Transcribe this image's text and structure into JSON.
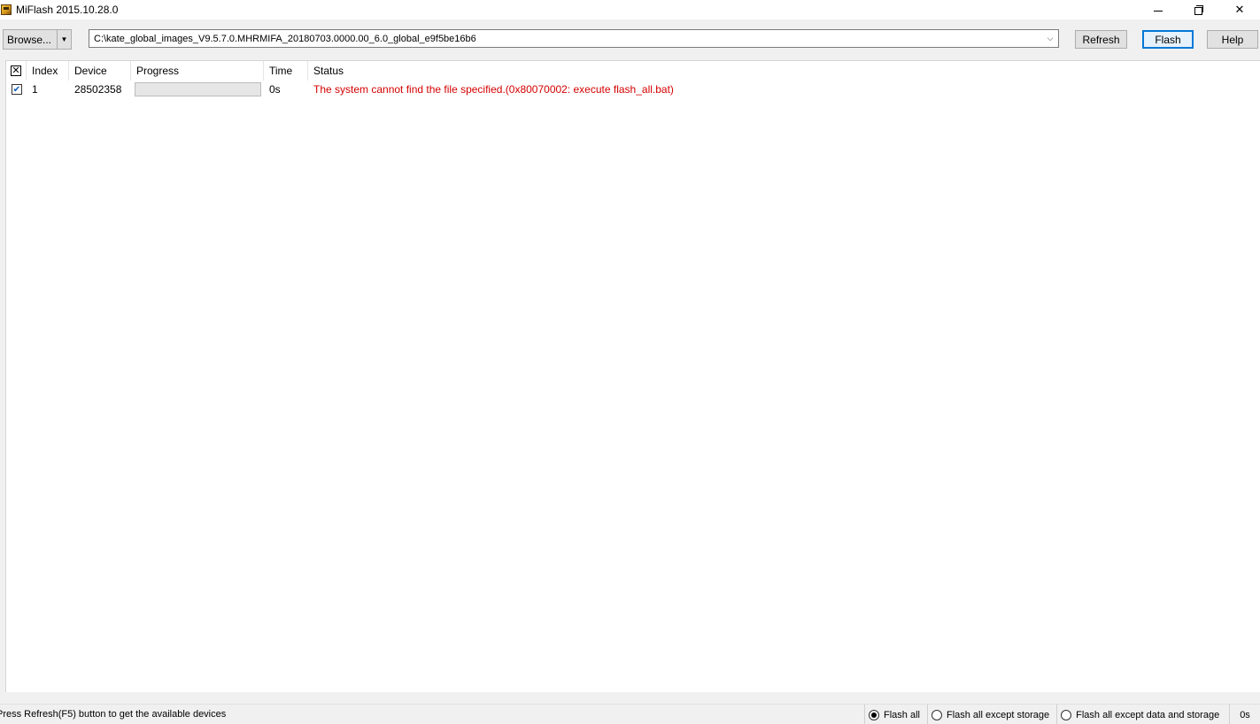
{
  "window": {
    "title": "MiFlash 2015.10.28.0",
    "icon": "miflash-app-icon",
    "controls": {
      "minimize": "minimize-icon",
      "restore": "restore-icon",
      "close": "✕"
    }
  },
  "toolbar": {
    "browse_label": "Browse...",
    "browse_dropdown": "▼",
    "path_value": "C:\\kate_global_images_V9.5.7.0.MHRMIFA_20180703.0000.00_6.0_global_e9f5be16b6",
    "path_dropdown": "⌵",
    "refresh_label": "Refresh",
    "flash_label": "Flash",
    "help_label": "Help"
  },
  "table": {
    "header_check": "✕",
    "columns": [
      "Index",
      "Device",
      "Progress",
      "Time",
      "Status"
    ],
    "rows": [
      {
        "checked": "✔",
        "index": "1",
        "device": "28502358",
        "progress": 0,
        "time": "0s",
        "status": "The system cannot find the file specified.(0x80070002: execute flash_all.bat)",
        "status_color": "#d40000"
      }
    ]
  },
  "statusbar": {
    "message": "Press Refresh(F5) button to get the available devices",
    "modes": [
      {
        "label": "Flash all",
        "selected": true
      },
      {
        "label": "Flash all except storage",
        "selected": false
      },
      {
        "label": "Flash all except data and storage",
        "selected": false
      }
    ],
    "elapsed": "0s"
  },
  "colors": {
    "accent": "#0078d7",
    "error": "#d40000",
    "progress_fill": "#06b025"
  }
}
